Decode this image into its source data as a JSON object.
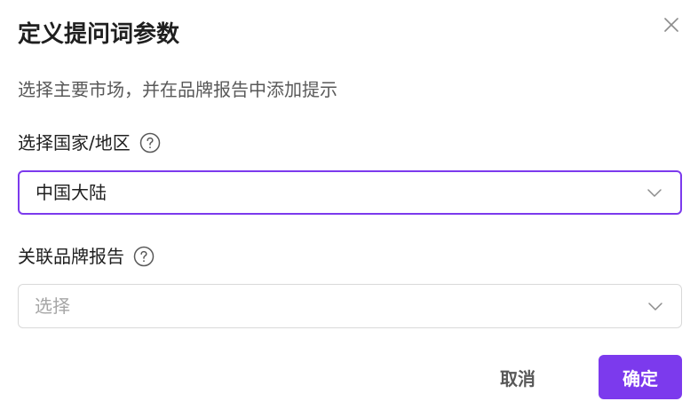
{
  "dialog": {
    "title": "定义提问词参数",
    "subtitle": "选择主要市场，并在品牌报告中添加提示",
    "close_icon": "close-icon"
  },
  "country_field": {
    "label": "选择国家/地区",
    "help_icon": "question-circle-icon",
    "selected_value": "中国大陆"
  },
  "report_field": {
    "label": "关联品牌报告",
    "help_icon": "question-circle-icon",
    "placeholder": "选择"
  },
  "actions": {
    "cancel_label": "取消",
    "confirm_label": "确定"
  },
  "colors": {
    "accent": "#7c3aed",
    "text_primary": "#1f1f1f",
    "text_secondary": "#595959",
    "placeholder": "#a6a6a6",
    "border": "#d9d9d9"
  }
}
